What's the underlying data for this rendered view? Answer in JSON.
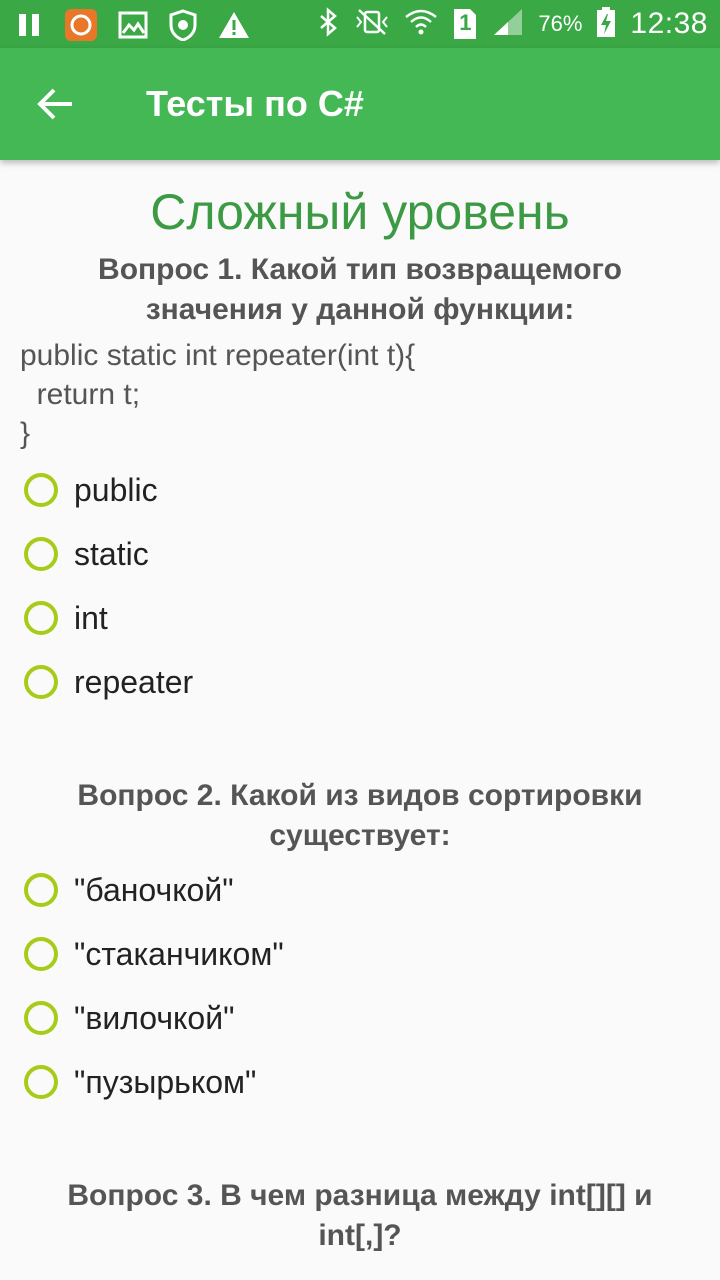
{
  "status_bar": {
    "icons": [
      "pause-icon",
      "app-notification-icon",
      "image-icon",
      "shield-icon",
      "warning-icon",
      "bluetooth-icon",
      "vibrate-icon",
      "wifi-icon",
      "sim-icon",
      "signal-icon",
      "battery-charging-icon"
    ],
    "sim_number": "1",
    "battery": "76%",
    "time": "12:38"
  },
  "app_bar": {
    "title": "Тесты по C#",
    "back_icon": "arrow-back-icon"
  },
  "level_title": "Сложный уровень",
  "questions": [
    {
      "text": "Вопрос 1. Какой тип возвращемого значения у данной функции:",
      "code": [
        "public static int repeater(int t){",
        "  return t;",
        "}"
      ],
      "options": [
        "public",
        "static",
        "int",
        "repeater"
      ]
    },
    {
      "text": "Вопрос 2. Какой из видов сортировки существует:",
      "options": [
        "\"баночкой\"",
        "\"стаканчиком\"",
        "\"вилочкой\"",
        "\"пузырьком\""
      ]
    },
    {
      "text": "Вопрос 3. В чем разница между int[][] и int[,]?"
    }
  ],
  "colors": {
    "status_bar": "#3aa845",
    "app_bar": "#43b854",
    "level_title": "#3c9a45",
    "radio": "#a6cc18"
  }
}
